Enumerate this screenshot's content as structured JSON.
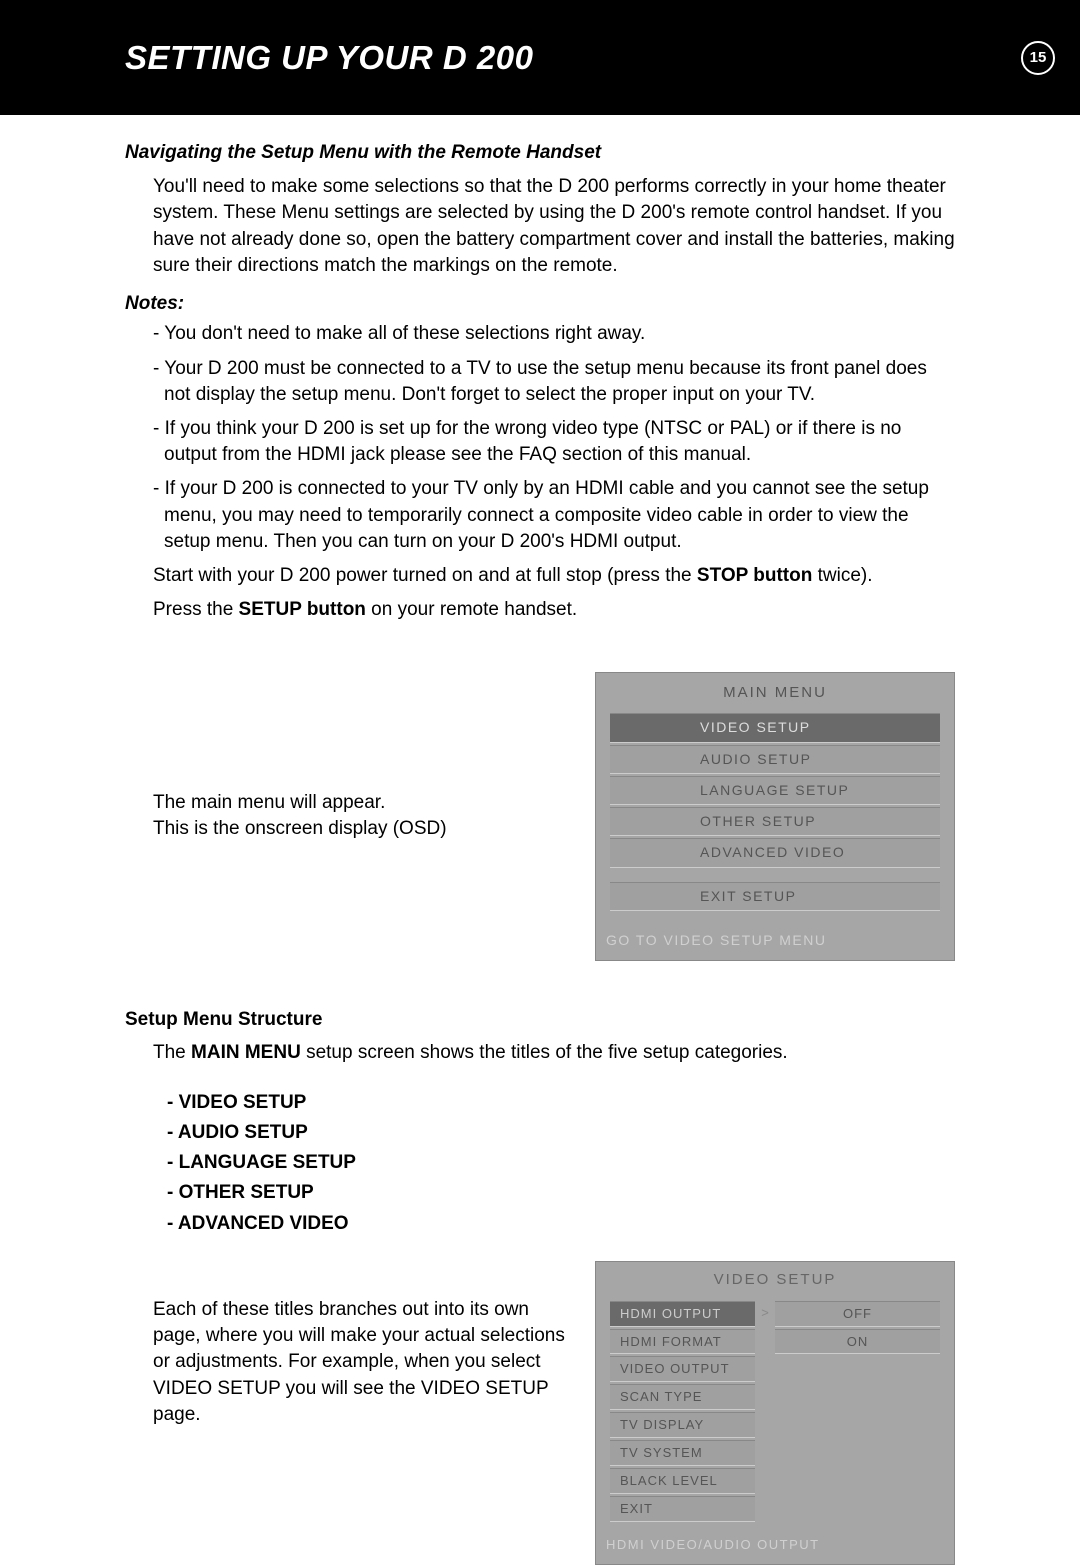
{
  "header": {
    "title": "SETTING UP YOUR D 200",
    "page_number": "15"
  },
  "section_heading": "Navigating the Setup Menu with the Remote Handset",
  "intro": "You'll need to make some selections so that the D 200 performs correctly in your home theater system. These Menu settings are selected by using the D 200's remote control handset. If you have not already done so, open the battery compartment cover and install the batteries, making sure their directions match the markings on the remote.",
  "notes_label": "Notes:",
  "notes": [
    "- You don't need to make all of these selections right away.",
    "- Your D 200 must be connected to a TV to use the setup menu because its front panel does not display the setup menu. Don't forget to select the proper input on your TV.",
    "- If you think your D 200 is set up for the wrong video type (NTSC or PAL) or if there is no output from the HDMI jack please see the FAQ section of this manual.",
    "- If your D 200 is connected to your TV only by an HDMI cable and you cannot see the setup menu, you may need to temporarily connect a composite video cable in order to view the setup menu. Then you can turn on your D 200's HDMI output."
  ],
  "start_para": {
    "prefix": "Start with your D 200 power turned on and at full stop (press the ",
    "bold": "STOP button",
    "suffix": " twice)."
  },
  "press_para": {
    "prefix": "Press the ",
    "bold": "SETUP button",
    "suffix": " on your remote handset."
  },
  "osd_intro": {
    "line1": "The main menu will appear.",
    "line2": "This is the onscreen display (OSD)"
  },
  "main_menu_osd": {
    "title": "MAIN MENU",
    "items": [
      "VIDEO SETUP",
      "AUDIO SETUP",
      "LANGUAGE SETUP",
      "OTHER SETUP",
      "ADVANCED VIDEO"
    ],
    "exit": "EXIT SETUP",
    "footer": "GO TO VIDEO SETUP MENU"
  },
  "structure_heading": "Setup Menu Structure",
  "structure_intro": {
    "prefix": "The ",
    "bold": "MAIN MENU",
    "suffix": " setup screen shows the titles of the five setup categories."
  },
  "setup_categories": [
    "- VIDEO SETUP",
    "- AUDIO SETUP",
    "- LANGUAGE SETUP",
    "- OTHER SETUP",
    "- ADVANCED VIDEO"
  ],
  "branches_para": "Each of these titles branches out into its own page, where you will make your actual selections or adjustments. For example, when you select VIDEO SETUP you will see the VIDEO SETUP page.",
  "video_setup_osd": {
    "title": "VIDEO SETUP",
    "rows": [
      {
        "label": "HDMI OUTPUT",
        "value": "OFF",
        "selected": true,
        "arrow": ">"
      },
      {
        "label": "HDMI FORMAT",
        "value": "ON",
        "selected": false,
        "arrow": ""
      },
      {
        "label": "VIDEO OUTPUT",
        "value": "",
        "selected": false,
        "arrow": ""
      },
      {
        "label": "SCAN TYPE",
        "value": "",
        "selected": false,
        "arrow": ""
      },
      {
        "label": "TV DISPLAY",
        "value": "",
        "selected": false,
        "arrow": ""
      },
      {
        "label": "TV SYSTEM",
        "value": "",
        "selected": false,
        "arrow": ""
      },
      {
        "label": "BLACK LEVEL",
        "value": "",
        "selected": false,
        "arrow": ""
      },
      {
        "label": "EXIT",
        "value": "",
        "selected": false,
        "arrow": ""
      }
    ],
    "footer": "HDMI VIDEO/AUDIO OUTPUT"
  }
}
